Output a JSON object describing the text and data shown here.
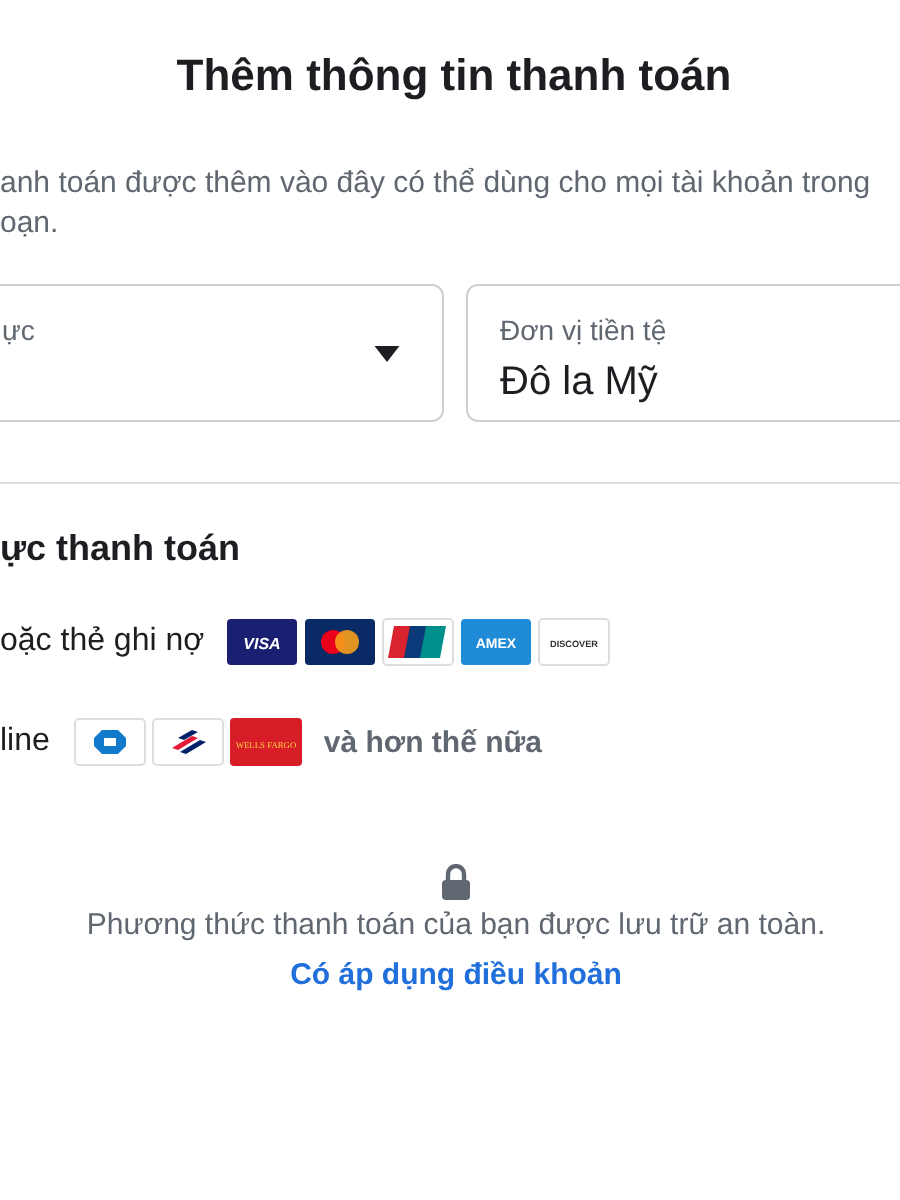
{
  "title": "Thêm thông tin thanh toán",
  "description": "anh toán được thêm vào đây có thể dùng cho mọi tài khoản trong\noạn.",
  "fields": [
    {
      "kind": "select",
      "label": "ực"
    },
    {
      "kind": "text",
      "label": "Đơn vị tiền tệ",
      "value": "Đô la Mỹ"
    }
  ],
  "section_title": "ực thanh toán",
  "methods": [
    {
      "label": "oặc thẻ ghi nợ",
      "logos": [
        {
          "kind": "visa",
          "label": "VISA"
        },
        {
          "kind": "mastercard"
        },
        {
          "kind": "unionpay"
        },
        {
          "kind": "amex",
          "label": "AMEX"
        },
        {
          "kind": "discover",
          "label": "DISCOVER"
        }
      ]
    },
    {
      "label": "line",
      "logos": [
        {
          "kind": "chase"
        },
        {
          "kind": "bofa"
        },
        {
          "kind": "wells",
          "label": "WELLS FARGO"
        }
      ],
      "more": "và hơn thế nữa"
    }
  ],
  "secure_note": "Phương thức thanh toán của bạn được lưu trữ an toàn.",
  "terms_link": "Có áp dụng điều khoản"
}
